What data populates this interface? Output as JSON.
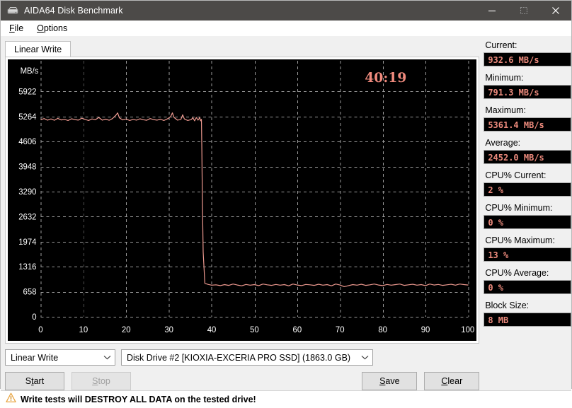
{
  "window": {
    "title": "AIDA64 Disk Benchmark",
    "icon": "disk-drive-icon",
    "minimize": "minimize-icon",
    "maximize": "maximize-icon",
    "close": "close-icon"
  },
  "menu": {
    "items": [
      {
        "label": "File",
        "accel": "F"
      },
      {
        "label": "Options",
        "accel": "O"
      }
    ]
  },
  "tabs": [
    {
      "label": "Linear Write",
      "active": true
    }
  ],
  "stats": [
    {
      "label": "Current:",
      "value": "932.6 MB/s",
      "name": "current"
    },
    {
      "label": "Minimum:",
      "value": "791.3 MB/s",
      "name": "minimum"
    },
    {
      "label": "Maximum:",
      "value": "5361.4 MB/s",
      "name": "maximum"
    },
    {
      "label": "Average:",
      "value": "2452.0 MB/s",
      "name": "average"
    },
    {
      "label": "CPU% Current:",
      "value": "2 %",
      "name": "cpu-current"
    },
    {
      "label": "CPU% Minimum:",
      "value": "0 %",
      "name": "cpu-minimum"
    },
    {
      "label": "CPU% Maximum:",
      "value": "13 %",
      "name": "cpu-maximum"
    },
    {
      "label": "CPU% Average:",
      "value": "0 %",
      "name": "cpu-average"
    },
    {
      "label": "Block Size:",
      "value": "8 MB",
      "name": "block-size"
    }
  ],
  "controls": {
    "test_mode": "Linear Write",
    "drive": "Disk Drive #2  [KIOXIA-EXCERIA PRO SSD]  (1863.0 GB)",
    "start": "Start",
    "start_accel": "t",
    "stop": "Stop",
    "stop_accel": "S",
    "save": "Save",
    "save_accel": "S",
    "clear": "Clear",
    "clear_accel": "C"
  },
  "warning": {
    "icon": "warning-triangle-icon",
    "text": "Write tests will DESTROY ALL DATA on the tested drive!"
  },
  "colors": {
    "titlebar": "#4c4a48",
    "plot_line": "#ef9a90",
    "value_text": "#ec8a7c",
    "chart_bg": "#000000",
    "grid": "#9a9a9a",
    "axis_text": "#ffffff",
    "timer_text": "#ef8a7d",
    "panel_bg": "#f0f0f0"
  },
  "chart_data": {
    "type": "line",
    "title": "",
    "xlabel": "",
    "ylabel": "MB/s",
    "elapsed_timer": "40:19",
    "xlim": [
      0,
      100
    ],
    "ylim": [
      0,
      6580
    ],
    "x_ticks": [
      0,
      10,
      20,
      30,
      40,
      50,
      60,
      70,
      80,
      90,
      100
    ],
    "x_tick_labels": [
      "0",
      "10",
      "20",
      "30",
      "40",
      "50",
      "60",
      "70",
      "80",
      "90",
      "100 %"
    ],
    "y_ticks": [
      0,
      658,
      1316,
      1974,
      2632,
      3290,
      3948,
      4606,
      5264,
      5922
    ],
    "y_tick_labels": [
      "0",
      "658",
      "1316",
      "1974",
      "2632",
      "3290",
      "3948",
      "4606",
      "5264",
      "5922"
    ],
    "grid": true,
    "grid_style": "dashed",
    "legend": "none",
    "series": [
      {
        "name": "Linear Write",
        "color": "#ef9a90",
        "x": [
          0.0,
          0.8,
          1.6,
          2.4,
          3.2,
          4.0,
          4.8,
          5.6,
          6.4,
          7.2,
          8.0,
          8.8,
          9.6,
          10.4,
          11.2,
          12.0,
          12.8,
          13.6,
          14.4,
          15.2,
          16.0,
          16.8,
          17.6,
          18.0,
          18.4,
          19.2,
          20.0,
          20.8,
          21.6,
          22.4,
          23.2,
          24.0,
          24.8,
          25.6,
          26.4,
          27.2,
          28.0,
          28.8,
          29.6,
          30.4,
          30.8,
          31.2,
          32.0,
          32.8,
          33.2,
          33.6,
          34.4,
          35.2,
          35.6,
          36.0,
          36.4,
          36.8,
          37.0,
          37.2,
          37.4,
          37.6,
          37.7,
          37.8,
          38.0,
          38.4,
          39.2,
          40.0,
          41.0,
          42.0,
          43.0,
          44.0,
          45.0,
          46.0,
          47.0,
          48.0,
          49.0,
          50.0,
          51.0,
          52.0,
          53.0,
          54.0,
          55.0,
          56.0,
          57.0,
          58.0,
          59.0,
          60.0,
          61.0,
          62.0,
          63.0,
          64.0,
          65.0,
          66.0,
          67.0,
          68.0,
          69.0,
          70.0,
          71.0,
          72.0,
          73.0,
          74.0,
          75.0,
          76.0,
          77.0,
          78.0,
          79.0,
          80.0,
          81.0,
          82.0,
          83.0,
          84.0,
          85.0,
          86.0,
          87.0,
          88.0,
          89.0,
          90.0,
          91.0,
          92.0,
          93.0,
          94.0,
          95.0,
          96.0,
          97.0,
          98.0,
          99.0,
          100.0
        ],
        "y": [
          5180,
          5210,
          5170,
          5200,
          5165,
          5215,
          5175,
          5190,
          5160,
          5205,
          5185,
          5170,
          5220,
          5190,
          5160,
          5200,
          5180,
          5240,
          5170,
          5195,
          5165,
          5210,
          5300,
          5361,
          5230,
          5175,
          5200,
          5160,
          5190,
          5170,
          5205,
          5180,
          5165,
          5210,
          5185,
          5170,
          5195,
          5160,
          5200,
          5260,
          5361,
          5240,
          5170,
          5190,
          5310,
          5200,
          5160,
          5185,
          5230,
          5150,
          5240,
          5170,
          5200,
          5240,
          5150,
          5190,
          4400,
          3200,
          1700,
          880,
          850,
          830,
          840,
          820,
          845,
          825,
          860,
          835,
          815,
          850,
          830,
          845,
          820,
          860,
          840,
          825,
          850,
          830,
          845,
          815,
          860,
          835,
          820,
          850,
          840,
          825,
          855,
          830,
          845,
          815,
          860,
          835,
          791,
          820,
          845,
          830,
          855,
          825,
          840,
          860,
          835,
          820,
          850,
          830,
          845,
          860,
          825,
          840,
          855,
          830,
          845,
          820,
          860,
          835,
          850,
          825,
          840,
          855,
          830,
          860,
          845,
          835,
          870
        ]
      }
    ]
  }
}
